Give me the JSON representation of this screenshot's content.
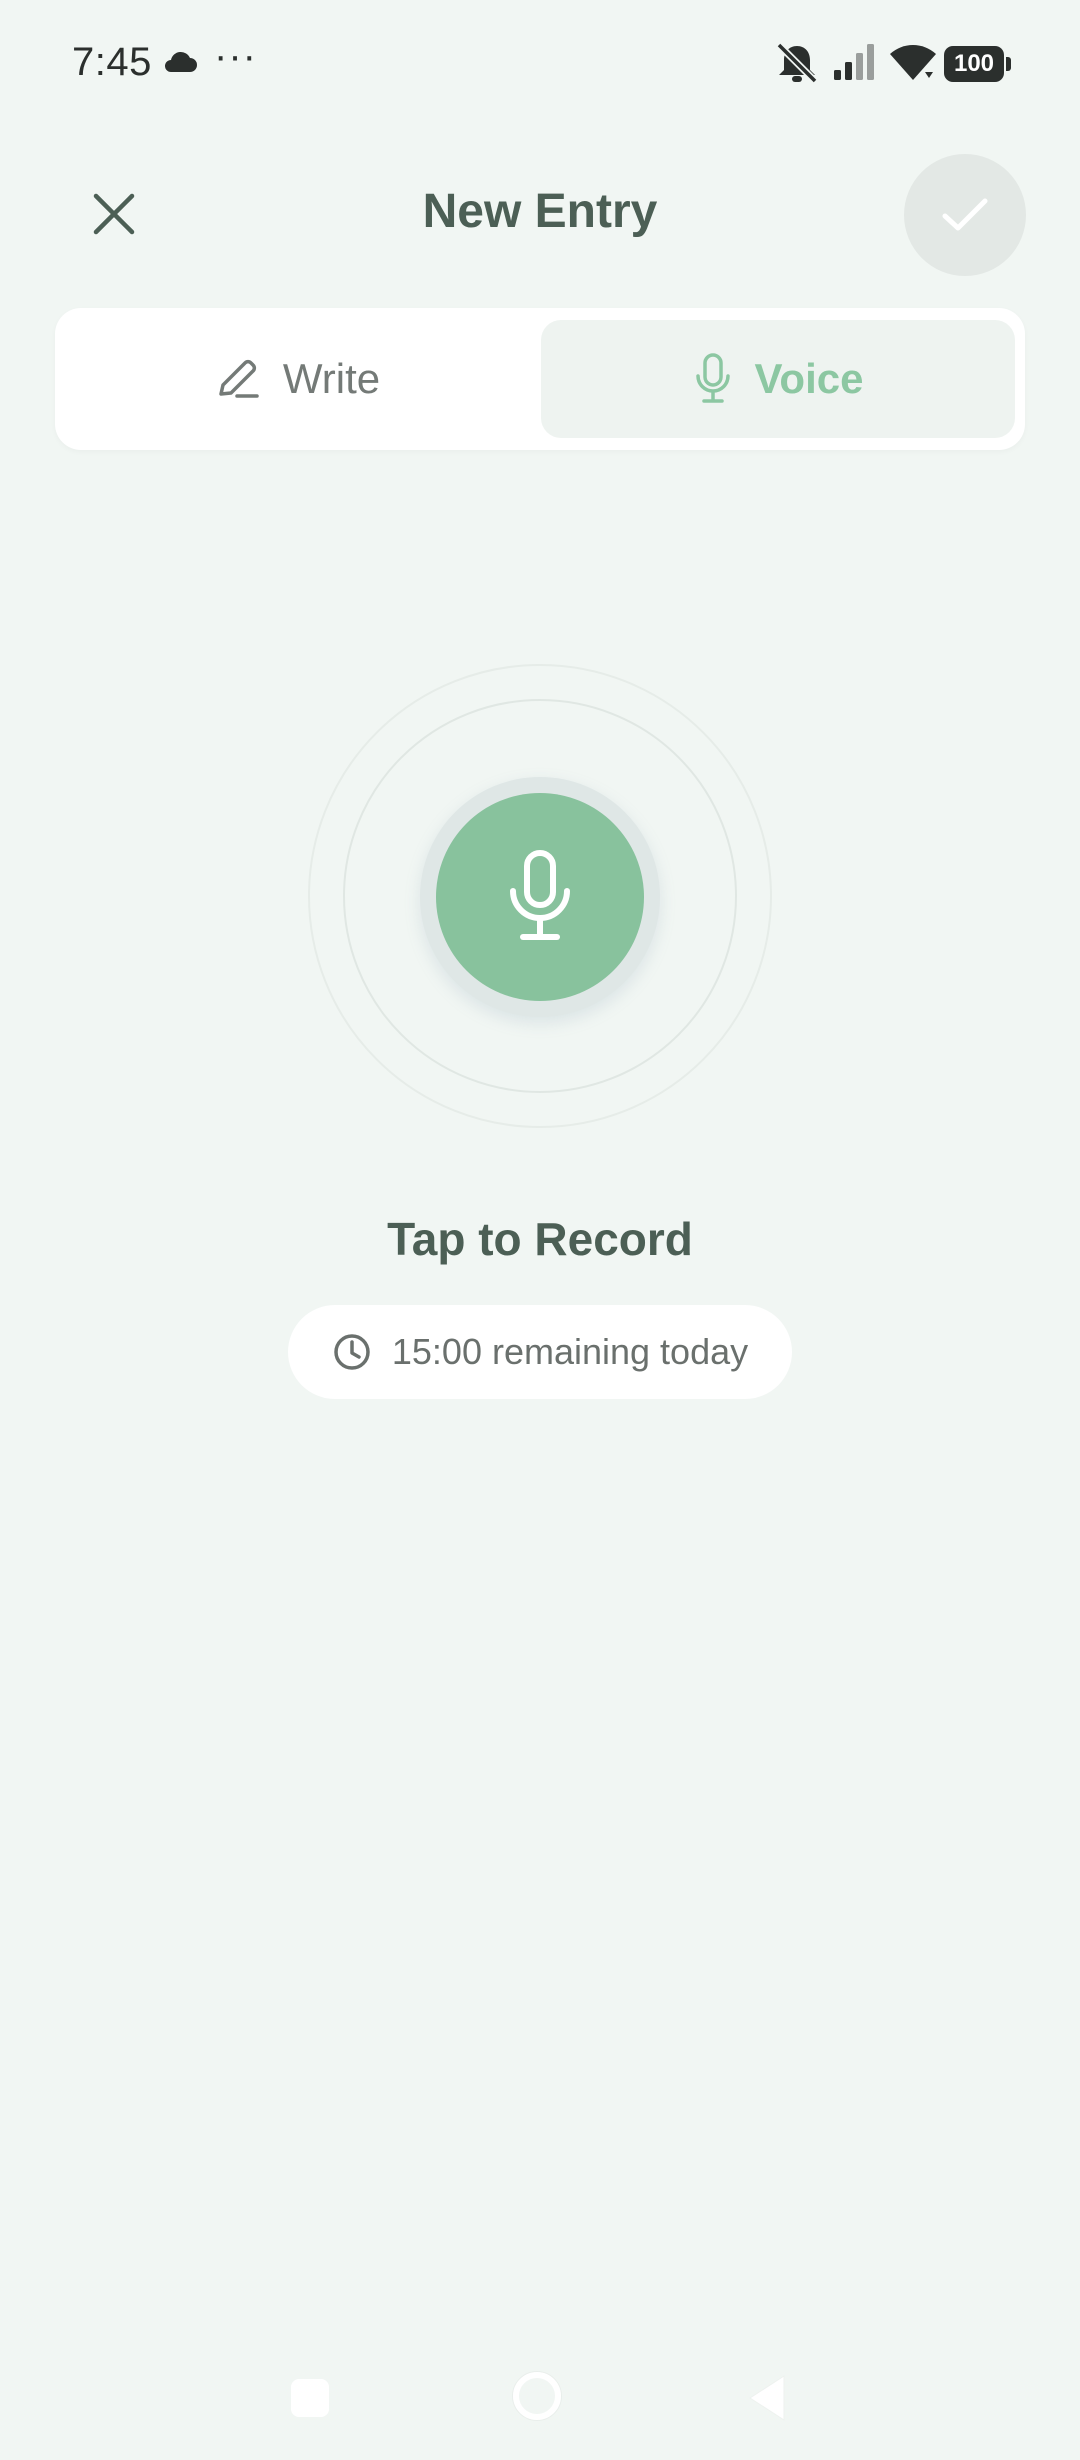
{
  "status_bar": {
    "time": "7:45",
    "overflow": "···",
    "battery": "100",
    "icons": [
      "cloud-icon",
      "bell-off-icon",
      "signal-icon",
      "wifi-icon",
      "battery-icon"
    ]
  },
  "header": {
    "title": "New Entry",
    "close_icon": "close-icon",
    "confirm_icon": "check-icon"
  },
  "mode_tabs": [
    {
      "label": "Write",
      "icon": "pencil-icon",
      "selected": false
    },
    {
      "label": "Voice",
      "icon": "microphone-icon",
      "selected": true
    }
  ],
  "record": {
    "icon": "microphone-icon",
    "label": "Tap to Record",
    "remaining": "15:00 remaining today",
    "remaining_icon": "clock-icon"
  },
  "nav_bar": {
    "icons": [
      "recent-apps-icon",
      "home-icon",
      "back-icon"
    ]
  },
  "colors": {
    "background": "#f1f6f3",
    "accent": "#88c29d",
    "accent_text": "#8cc7a2",
    "title_text": "#4c5f55",
    "confirm_disabled": "#e3e8e5"
  }
}
